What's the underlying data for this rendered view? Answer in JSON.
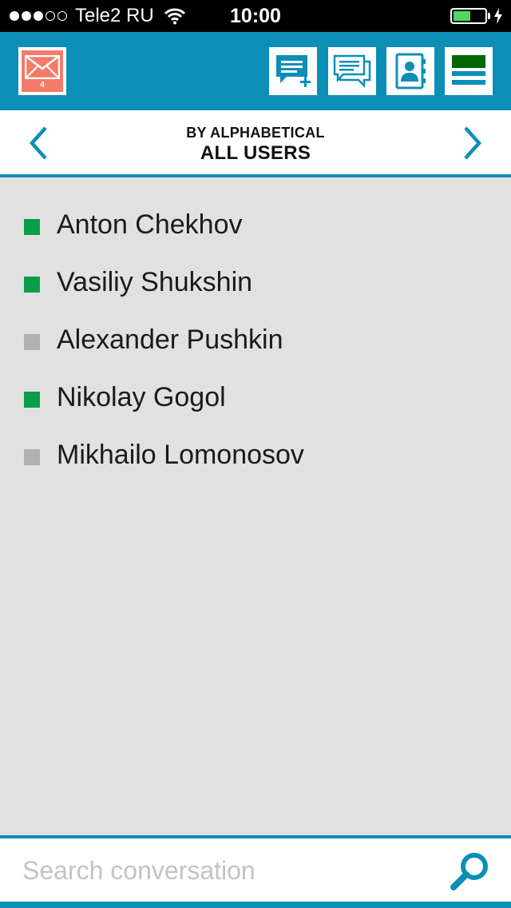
{
  "status_bar": {
    "carrier": "Tele2 RU",
    "time": "10:00",
    "signal_bars_filled": 3,
    "signal_bars_total": 5,
    "battery_level": 0.55,
    "charging": true
  },
  "toolbar": {
    "mail_badge_count": "4",
    "mail_icon": "envelope-icon",
    "buttons": [
      {
        "name": "new-chat-button",
        "icon": "new-message-icon"
      },
      {
        "name": "conversations-button",
        "icon": "chat-bubbles-icon"
      },
      {
        "name": "contacts-button",
        "icon": "contact-book-icon"
      },
      {
        "name": "menu-button",
        "icon": "menu-icon"
      }
    ],
    "colors": {
      "bar": "#0b8fb7",
      "mail_bg": "#f47b6a",
      "menu_accent": "#006600"
    }
  },
  "header": {
    "subtitle": "BY ALPHABETICAL",
    "title": "ALL USERS"
  },
  "users": [
    {
      "name": "Anton Chekhov",
      "status": "online"
    },
    {
      "name": "Vasiliy Shukshin",
      "status": "online"
    },
    {
      "name": "Alexander Pushkin",
      "status": "offline"
    },
    {
      "name": "Nikolay Gogol",
      "status": "online"
    },
    {
      "name": "Mikhailo Lomonosov",
      "status": "offline"
    }
  ],
  "status_colors": {
    "online": "#0a9e4a",
    "offline": "#b1b1b1"
  },
  "search": {
    "placeholder": "Search conversation",
    "value": ""
  }
}
